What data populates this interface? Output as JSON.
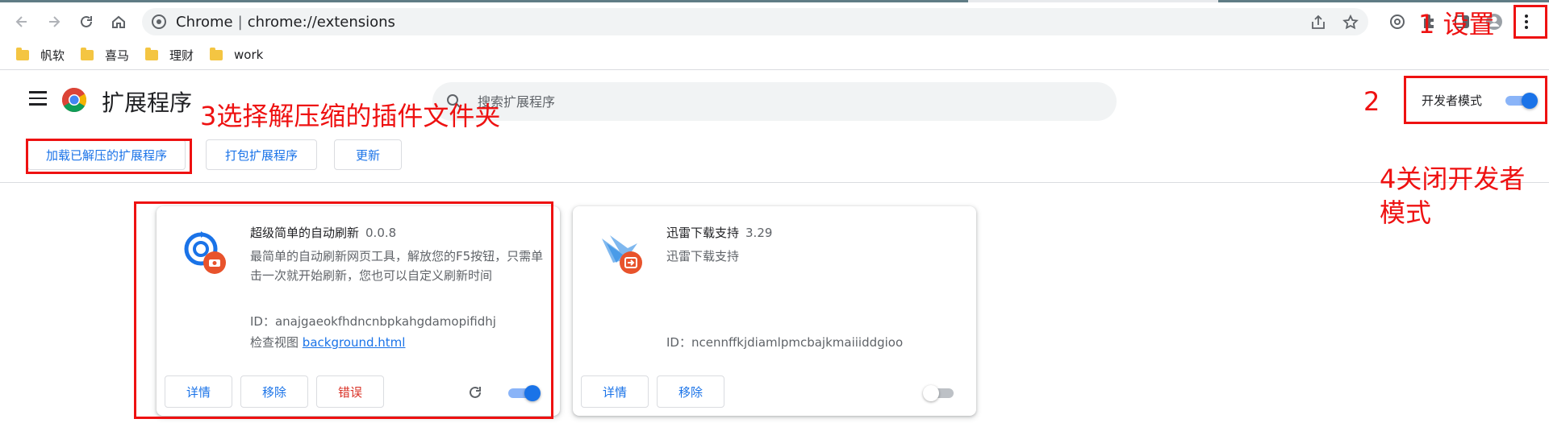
{
  "browser": {
    "url_site": "Chrome",
    "url_path": "chrome://extensions",
    "bookmarks": [
      "帆软",
      "喜马",
      "理财",
      "work"
    ]
  },
  "header": {
    "title": "扩展程序",
    "search_placeholder": "搜索扩展程序",
    "dev_mode_label": "开发者模式",
    "dev_mode_on": true
  },
  "actions": {
    "load_unpacked": "加载已解压的扩展程序",
    "pack": "打包扩展程序",
    "update": "更新"
  },
  "extensions": [
    {
      "name": "超级简单的自动刷新",
      "version": "0.0.8",
      "description": "最简单的自动刷新网页工具，解放您的F5按钮，只需单击一次就开始刷新，您也可以自定义刷新时间",
      "id": "ID：anajgaeokfhdncnbpkahgdamopifidhj",
      "views_label": "检查视图",
      "views_link": "background.html",
      "btn_details": "详情",
      "btn_remove": "移除",
      "btn_errors": "错误",
      "enabled": true
    },
    {
      "name": "迅雷下载支持",
      "version": "3.29",
      "description": "迅雷下载支持",
      "id": "ID：ncennffkjdiamlpmcbajkmaiiiddgioo",
      "btn_details": "详情",
      "btn_remove": "移除",
      "enabled": false
    }
  ],
  "annotations": {
    "step1": "1 设置",
    "step2": "2",
    "step3": "3选择解压缩的插件文件夹",
    "step4_line1": "4关闭开发者",
    "step4_line2": "模式"
  },
  "colors": {
    "accent": "#1a73e8",
    "annotation": "#ee1111",
    "error": "#d93025"
  }
}
